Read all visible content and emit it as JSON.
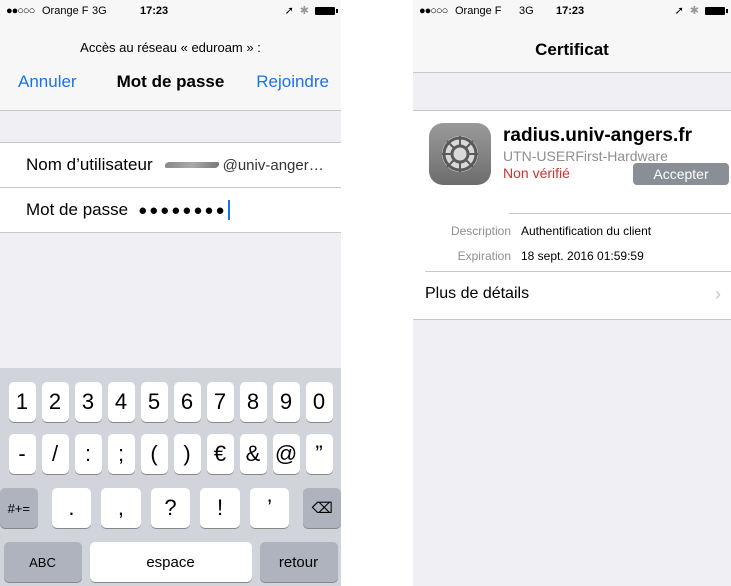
{
  "left": {
    "status": {
      "dots": "●●○○○",
      "carrier": "Orange F",
      "network": "3G",
      "time": "17:23",
      "icons": "location-arrow-icon, bluetooth-icon, battery-icon"
    },
    "prompt": "Accès au réseau « eduroam » :",
    "nav": {
      "cancel": "Annuler",
      "title": "Mot de passe",
      "join": "Rejoindre"
    },
    "form": {
      "username_label": "Nom d’utilisateur",
      "username_value": "@univ-anger…",
      "password_label": "Mot de passe",
      "password_value": "●●●●●●●●"
    },
    "keyboard": {
      "row1": [
        "1",
        "2",
        "3",
        "4",
        "5",
        "6",
        "7",
        "8",
        "9",
        "0"
      ],
      "row2": [
        "-",
        "/",
        ":",
        ";",
        "(",
        ")",
        "€",
        "&",
        "@",
        "”"
      ],
      "row3": [
        "#+=",
        ".",
        ",",
        "?",
        "!",
        "’",
        "⌫"
      ],
      "row4": [
        "ABC",
        "espace",
        "retour"
      ]
    }
  },
  "right": {
    "status": {
      "dots": "●●○○○",
      "carrier": "Orange F",
      "network": "3G",
      "time": "17:23"
    },
    "title": "Certificat",
    "cert": {
      "name": "radius.univ-angers.fr",
      "issuer": "UTN-USERFirst-Hardware",
      "status": "Non vérifié",
      "accept": "Accepter",
      "icon": "settings-gear-icon",
      "description_label": "Description",
      "description_value": "Authentification du client",
      "expiration_label": "Expiration",
      "expiration_value": "18 sept. 2016 01:59:59",
      "more_details": "Plus de détails"
    }
  },
  "colors": {
    "accent": "#1a73e8",
    "warning": "#d0312d",
    "accept_btn": "#8a8f96"
  }
}
